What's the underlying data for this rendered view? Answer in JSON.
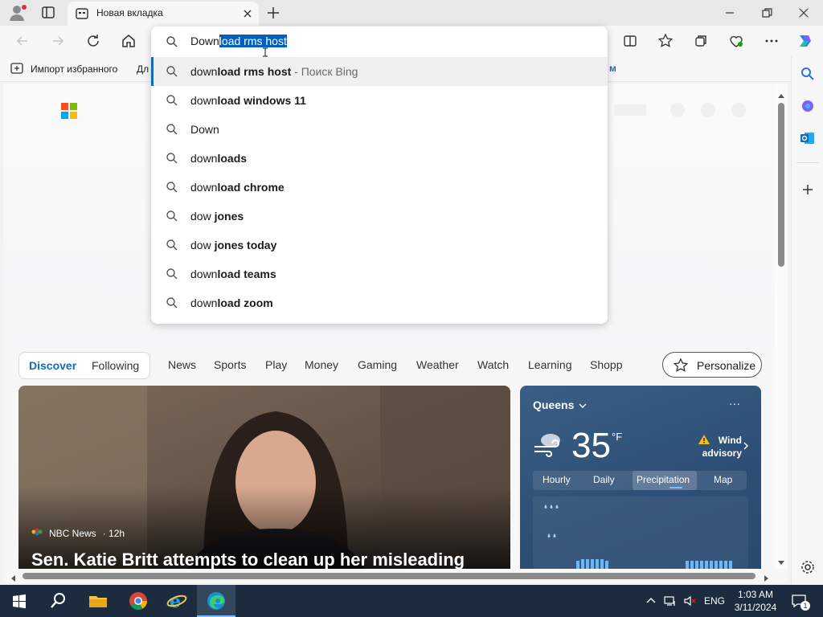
{
  "browser": {
    "tab_title": "Новая вкладка",
    "favorites_import_label": "Импорт избранного",
    "favorites_partial_label": "Дл",
    "favorites_overflow_text": "м"
  },
  "omnibox": {
    "typed_prefix": "Down",
    "autocomplete_selected": "load rms host",
    "suggestions": [
      {
        "prefix": "down",
        "bold": "load rms host",
        "hint": " - Поиск Bing"
      },
      {
        "prefix": "down",
        "bold": "load windows 11",
        "hint": ""
      },
      {
        "prefix": "Down",
        "bold": "",
        "hint": ""
      },
      {
        "prefix": "down",
        "bold": "loads",
        "hint": ""
      },
      {
        "prefix": "down",
        "bold": "load chrome",
        "hint": ""
      },
      {
        "prefix": "dow ",
        "bold": "jones",
        "hint": ""
      },
      {
        "prefix": "dow ",
        "bold": "jones today",
        "hint": ""
      },
      {
        "prefix": "down",
        "bold": "load teams",
        "hint": ""
      },
      {
        "prefix": "down",
        "bold": "load zoom",
        "hint": ""
      }
    ]
  },
  "feed": {
    "discover": "Discover",
    "following": "Following",
    "nav": [
      "News",
      "Sports",
      "Play",
      "Money",
      "Gaming",
      "Weather",
      "Watch",
      "Learning",
      "Shopp"
    ],
    "personalize": "Personalize"
  },
  "news_card": {
    "source": "NBC News",
    "age": "· 12h",
    "headline": "Sen. Katie Britt attempts to clean up her misleading"
  },
  "weather": {
    "location": "Queens",
    "more": "···",
    "temperature": "35",
    "unit": "°F",
    "alert_line1": "Wind",
    "alert_line2": "advisory",
    "tabs": [
      "Hourly",
      "Daily",
      "Precipitation",
      "Map"
    ],
    "active_tab": "Precipitation"
  },
  "taskbar": {
    "language": "ENG",
    "time": "1:03 AM",
    "date": "3/11/2024",
    "notifications": "1"
  },
  "colors": {
    "accent": "#0f6cbd",
    "selection": "#0060c0",
    "taskbar": "#1c2b3d"
  }
}
